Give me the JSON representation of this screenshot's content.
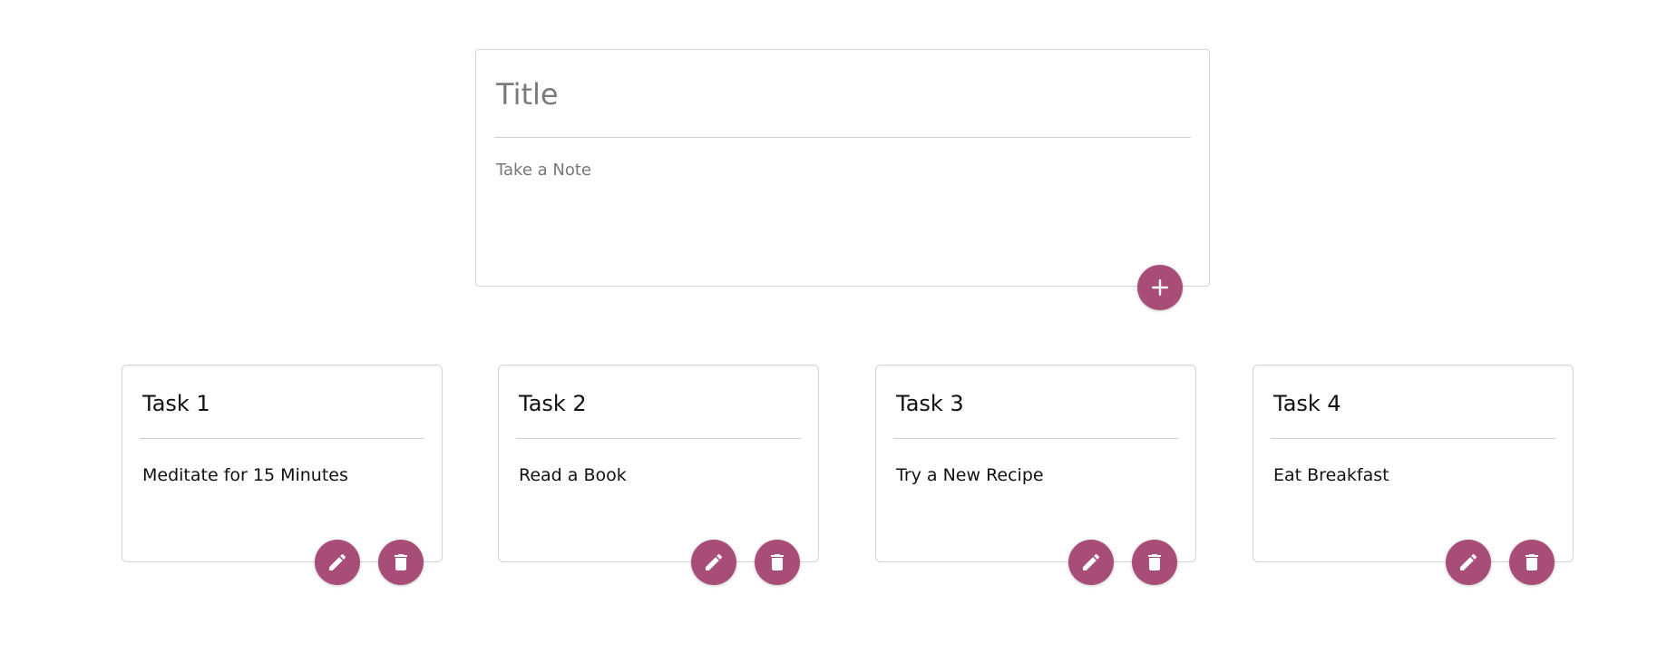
{
  "create_note": {
    "title_placeholder": "Title",
    "title_value": "",
    "content_placeholder": "Take a Note",
    "content_value": "",
    "add_button_icon": "plus-icon"
  },
  "notes": [
    {
      "title": "Task 1",
      "content": "Meditate for 15 Minutes"
    },
    {
      "title": "Task 2",
      "content": "Read a Book"
    },
    {
      "title": "Task 3",
      "content": "Try a New Recipe"
    },
    {
      "title": "Task 4",
      "content": "Eat Breakfast"
    }
  ],
  "note_actions": {
    "edit_icon": "pencil-icon",
    "delete_icon": "trash-icon"
  },
  "colors": {
    "accent": "#a84d77",
    "card_border": "#d4d4d4",
    "divider": "#cfcfcf",
    "placeholder_text": "#7a7a7a",
    "body_text": "#111111"
  }
}
